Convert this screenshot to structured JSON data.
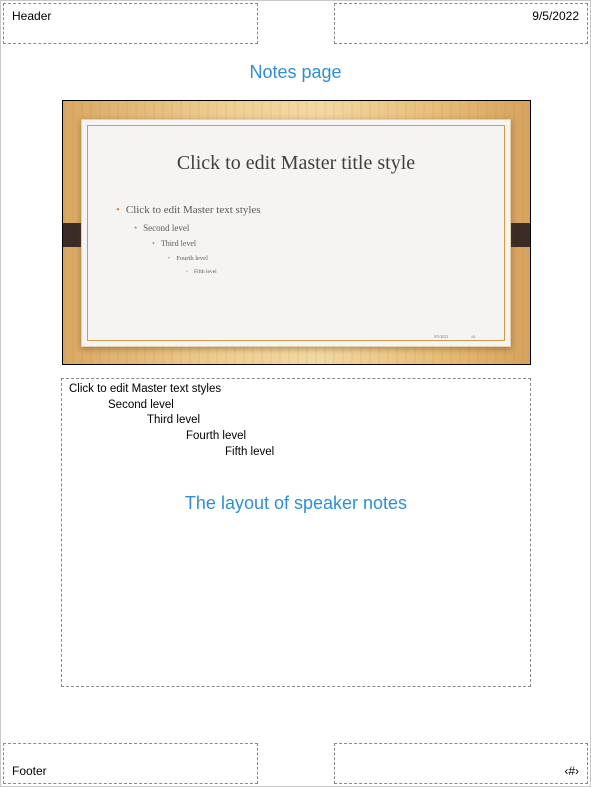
{
  "header": {
    "text": "Header",
    "date": "9/5/2022"
  },
  "footer": {
    "text": "Footer",
    "page_number": "‹#›"
  },
  "annotations": {
    "top": "Notes page",
    "notes": "The layout of speaker notes"
  },
  "slide": {
    "title": "Click to edit Master title style",
    "bullets": [
      "Click to edit Master text styles",
      "Second level",
      "Third level",
      "Fourth level",
      "Fifth level"
    ],
    "bullet_symbol": "•",
    "date": "9/5/2022",
    "number": "‹#›",
    "colors": {
      "accent": "#d98b2b",
      "background_wood": "#efcf93",
      "tab": "#3a2d26"
    }
  },
  "notes": {
    "levels": [
      "Click to edit Master text styles",
      "Second level",
      "Third level",
      "Fourth level",
      "Fifth level"
    ]
  },
  "colors": {
    "annotation": "#2d8fd9"
  }
}
